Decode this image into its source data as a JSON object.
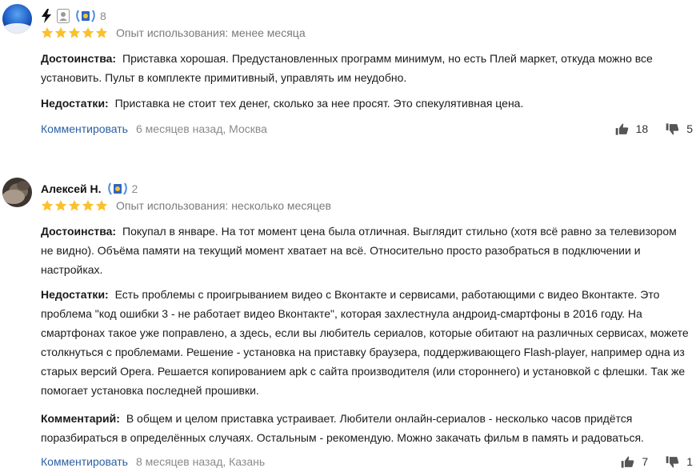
{
  "reviews": [
    {
      "author": "",
      "achievements_count": "8",
      "rating": 5,
      "experience": "Опыт использования: менее месяца",
      "pros_label": "Достоинства:",
      "pros": "Приставка хорошая. Предустановленных программ минимум, но есть Плей маркет, откуда можно все установить. Пульт в комплекте примитивный, управлять им неудобно.",
      "cons_label": "Недостатки:",
      "cons": "Приставка не стоит тех денег, сколько за нее просят. Это спекулятивная цена.",
      "comment_action": "Комментировать",
      "date_city": "6 месяцев назад, Москва",
      "likes": "18",
      "dislikes": "5"
    },
    {
      "author": "Алексей Н.",
      "achievements_count": "2",
      "rating": 5,
      "experience": "Опыт использования: несколько месяцев",
      "pros_label": "Достоинства:",
      "pros": "Покупал в январе. На тот момент цена была отличная. Выглядит стильно (хотя всё равно за телевизором не видно). Объёма памяти на текущий момент хватает на всё. Относительно просто разобраться в подключении и настройках.",
      "cons_label": "Недостатки:",
      "cons": "Есть проблемы с проигрыванием видео с Вконтакте и сервисами, работающими с видео Вконтакте. Это проблема \"код ошибки 3 - не работает видео Вконтакте\", которая захлестнула андроид-смартфоны в 2016 году. На смартфонах такое уже поправлено, а здесь, если вы любитель сериалов, которые обитают на различных сервисах, можете столкнуться с проблемами. Решение - установка на приставку браузера, поддерживающего Flash-player, например одна из старых версий Opera. Решается копированием apk с сайта производителя (или стороннего) и установкой с флешки. Так же помогает установка последней прошивки.",
      "comment_label": "Комментарий:",
      "comment": "В общем и целом приставка устраивает. Любители онлайн-сериалов - несколько часов придётся поразбираться в определённых случаях. Остальным - рекомендую. Можно закачать фильм в память и радоваться.",
      "comment_action": "Комментировать",
      "date_city": "8 месяцев назад, Казань",
      "likes": "7",
      "dislikes": "1"
    }
  ],
  "colors": {
    "star": "#fbc02d",
    "link": "#2a5fa3",
    "muted": "#8a8a8a"
  }
}
